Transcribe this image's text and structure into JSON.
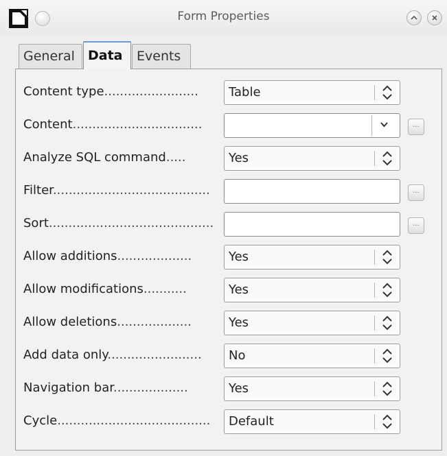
{
  "window": {
    "title": "Form Properties"
  },
  "tabs": [
    {
      "label": "General"
    },
    {
      "label": "Data"
    },
    {
      "label": "Events"
    }
  ],
  "rows": [
    {
      "label": "Content type",
      "dots": "........................",
      "value": "Table"
    },
    {
      "label": "Content",
      "dots": ".................................",
      "value": ""
    },
    {
      "label": "Analyze SQL command",
      "dots": ".....",
      "value": "Yes"
    },
    {
      "label": "Filter",
      "dots": "........................................",
      "value": ""
    },
    {
      "label": "Sort",
      "dots": "..........................................",
      "value": ""
    },
    {
      "label": "Allow additions",
      "dots": "...................",
      "value": "Yes"
    },
    {
      "label": "Allow modifications",
      "dots": "...........",
      "value": "Yes"
    },
    {
      "label": "Allow deletions",
      "dots": "...................",
      "value": "Yes"
    },
    {
      "label": "Add data only",
      "dots": "........................",
      "value": "No"
    },
    {
      "label": "Navigation bar",
      "dots": "...................",
      "value": "Yes"
    },
    {
      "label": "Cycle",
      "dots": ".......................................",
      "value": "Default"
    }
  ],
  "browse_button": {
    "label": "..."
  },
  "icons": {
    "app": "libreoffice-doc-icon",
    "minimize": "minimize-icon",
    "rollup": "chevron-up-icon",
    "close": "close-icon",
    "spin": "up-down-spinner-icon",
    "dropdown": "chevron-down-icon"
  }
}
